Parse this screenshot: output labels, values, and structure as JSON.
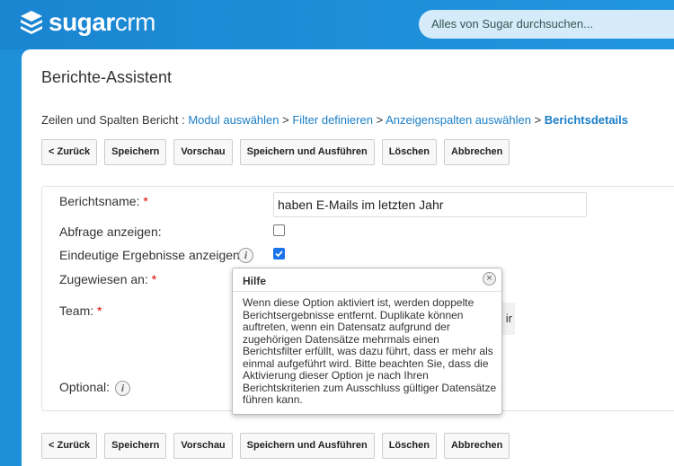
{
  "header": {
    "logo_bold": "sugar",
    "logo_thin": "crm",
    "search_placeholder": "Alles von Sugar durchsuchen..."
  },
  "page": {
    "title": "Berichte-Assistent"
  },
  "breadcrumb": {
    "prefix": "Zeilen und Spalten Bericht : ",
    "steps": [
      "Modul auswählen",
      "Filter definieren",
      "Anzeigenspalten auswählen",
      "Berichtsdetails"
    ],
    "separator": " > "
  },
  "buttons": {
    "back": "< Zurück",
    "save": "Speichern",
    "preview": "Vorschau",
    "save_run": "Speichern und Ausführen",
    "delete": "Löschen",
    "cancel": "Abbrechen"
  },
  "form": {
    "report_name_label": "Berichtsname:",
    "report_name_value": "haben E-Mails im letzten Jahr",
    "show_query_label": "Abfrage anzeigen:",
    "show_query_checked": false,
    "unique_results_label": "Eindeutige Ergebnisse anzeigen:",
    "unique_results_checked": true,
    "assigned_label": "Zugewiesen an:",
    "team_label": "Team:",
    "team_fragment": "ir",
    "optional_label": "Optional:",
    "required_marker": "*",
    "info_glyph": "i"
  },
  "help_popup": {
    "title": "Hilfe",
    "close_glyph": "×",
    "text": "Wenn diese Option aktiviert ist, werden doppelte Berichtsergebnisse entfernt. Duplikate können auftreten, wenn ein Datensatz aufgrund der zugehörigen Datensätze mehrmals einen Berichtsfilter erfüllt, was dazu führt, dass er mehr als einmal aufgeführt wird. Bitte beachten Sie, dass die Aktivierung dieser Option je nach Ihren Berichtskriterien zum Ausschluss gültiger Datensätze führen kann."
  },
  "colors": {
    "header_blue": "#1e8fd9",
    "link_blue": "#1a7ec8",
    "checkbox_blue": "#1a73e8",
    "required_red": "#dd0000"
  }
}
